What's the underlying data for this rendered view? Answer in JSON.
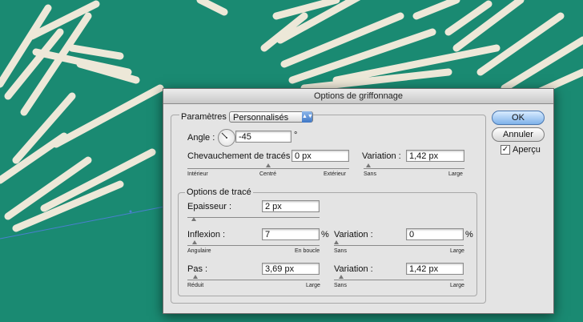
{
  "dialog": {
    "title": "Options de griffonnage",
    "parametres_label": "Paramètres :",
    "parametres_value": "Personnalisés",
    "angle_label": "Angle :",
    "angle_value": "-45",
    "degree_symbol": "°",
    "chevauchement_label": "Chevauchement de tracés :",
    "chevauchement_value": "0 px",
    "chevauchement_slider": {
      "min": "Intérieur",
      "mid": "Centré",
      "max": "Extérieur"
    },
    "variation1_label": "Variation :",
    "variation1_value": "1,42 px",
    "variation1_slider": {
      "min": "Sans",
      "max": "Large"
    },
    "trace_group_title": "Options de tracé",
    "epaisseur_label": "Epaisseur :",
    "epaisseur_value": "2 px",
    "inflexion_label": "Inflexion :",
    "inflexion_value": "7",
    "inflexion_unit": "%",
    "inflexion_slider": {
      "min": "Angulaire",
      "max": "En boucle"
    },
    "variation2_label": "Variation :",
    "variation2_value": "0",
    "variation2_unit": "%",
    "variation2_slider": {
      "min": "Sans",
      "max": "Large"
    },
    "pas_label": "Pas :",
    "pas_value": "3,69 px",
    "pas_slider": {
      "min": "Réduit",
      "max": "Large"
    },
    "variation3_label": "Variation :",
    "variation3_value": "1,42 px",
    "variation3_slider": {
      "min": "Sans",
      "max": "Large"
    },
    "ok_label": "OK",
    "annuler_label": "Annuler",
    "apercu_label": "Aperçu",
    "apercu_checked": true
  },
  "colors": {
    "background": "#1a8a72",
    "scribble": "#ede8d8",
    "dialog": "#e4e4e4"
  }
}
